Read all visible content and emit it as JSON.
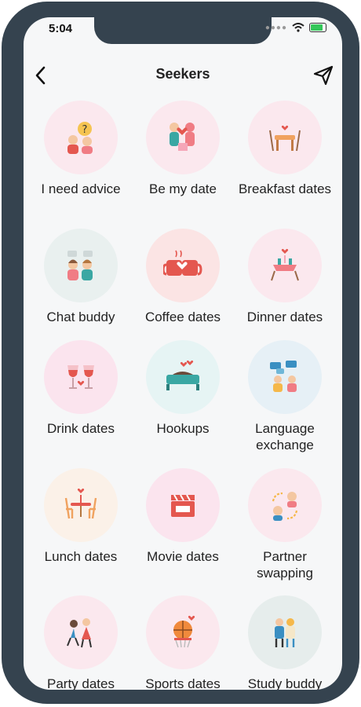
{
  "status_bar": {
    "time": "5:04"
  },
  "header": {
    "title": "Seekers"
  },
  "categories": [
    {
      "label": "I need advice",
      "icon": "advice-icon",
      "bg": "#fbe8ee"
    },
    {
      "label": "Be my date",
      "icon": "couple-gift-icon",
      "bg": "#fbe8ee"
    },
    {
      "label": "Breakfast dates",
      "icon": "breakfast-table-icon",
      "bg": "#fbe8ee"
    },
    {
      "label": "Chat buddy",
      "icon": "chat-buddy-icon",
      "bg": "#e9f0ef"
    },
    {
      "label": "Coffee dates",
      "icon": "coffee-cups-icon",
      "bg": "#fbe4e4"
    },
    {
      "label": "Dinner dates",
      "icon": "dinner-table-icon",
      "bg": "#fbe8ee"
    },
    {
      "label": "Drink dates",
      "icon": "wine-glasses-icon",
      "bg": "#fbe4ee"
    },
    {
      "label": "Hookups",
      "icon": "bed-hearts-icon",
      "bg": "#e6f4f4"
    },
    {
      "label": "Language exchange",
      "icon": "language-exchange-icon",
      "bg": "#e6f0f6"
    },
    {
      "label": "Lunch dates",
      "icon": "lunch-table-icon",
      "bg": "#fbf1e8"
    },
    {
      "label": "Movie dates",
      "icon": "clapperboard-icon",
      "bg": "#fbe4ee"
    },
    {
      "label": "Partner swapping",
      "icon": "partner-swap-icon",
      "bg": "#fbe8ee"
    },
    {
      "label": "Party dates",
      "icon": "dancing-people-icon",
      "bg": "#fbe8ee"
    },
    {
      "label": "Sports dates",
      "icon": "basketball-icon",
      "bg": "#fbe8ee"
    },
    {
      "label": "Study buddy",
      "icon": "study-buddy-icon",
      "bg": "#e6edec"
    }
  ]
}
